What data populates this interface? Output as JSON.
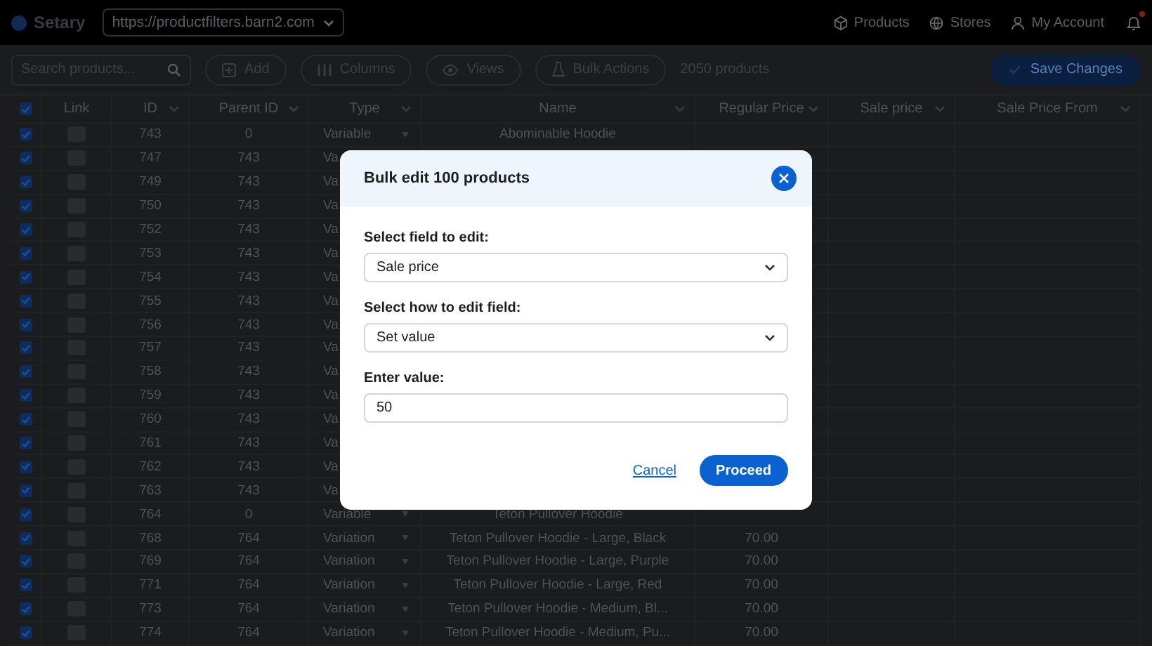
{
  "app_bar": {
    "logo": "Setary",
    "site_url": "https://productfilters.barn2.com",
    "nav": [
      {
        "label": "Products"
      },
      {
        "label": "Stores"
      },
      {
        "label": "My Account"
      }
    ],
    "notifications": {
      "unread": true
    }
  },
  "toolbar": {
    "search": {
      "placeholder": "Search products..."
    },
    "buttons": [
      {
        "label": "Add"
      },
      {
        "label": "Columns"
      },
      {
        "label": "Views"
      },
      {
        "label": "Bulk Actions"
      }
    ],
    "count": "2050 products",
    "save_button": "Save Changes"
  },
  "table": {
    "select_all": {
      "checked": true
    },
    "columns": [
      {
        "label": "Link",
        "filter": false
      },
      {
        "label": "ID",
        "filter": true
      },
      {
        "label": "Parent ID",
        "filter": true
      },
      {
        "label": "Type",
        "filter": true
      },
      {
        "label": "Name",
        "filter": true
      },
      {
        "label": "Regular Price",
        "filter": true
      },
      {
        "label": "Sale price",
        "filter": true
      },
      {
        "label": "Sale Price From",
        "filter": true
      }
    ],
    "rows": [
      {
        "checked": true,
        "id": "743",
        "parent_id": "0",
        "type": "Variable",
        "dropdown": true,
        "name": "Abominable Hoodie"
      },
      {
        "checked": true,
        "id": "747",
        "parent_id": "743",
        "type": "Va",
        "dropdown": false
      },
      {
        "checked": true,
        "id": "749",
        "parent_id": "743",
        "type": "Va",
        "dropdown": false
      },
      {
        "checked": true,
        "id": "750",
        "parent_id": "743",
        "type": "Va",
        "dropdown": false
      },
      {
        "checked": true,
        "id": "752",
        "parent_id": "743",
        "type": "Va",
        "dropdown": false
      },
      {
        "checked": true,
        "id": "753",
        "parent_id": "743",
        "type": "Va",
        "dropdown": false
      },
      {
        "checked": true,
        "id": "754",
        "parent_id": "743",
        "type": "Va",
        "dropdown": false
      },
      {
        "checked": true,
        "id": "755",
        "parent_id": "743",
        "type": "Va",
        "dropdown": false
      },
      {
        "checked": true,
        "id": "756",
        "parent_id": "743",
        "type": "Va",
        "dropdown": false
      },
      {
        "checked": true,
        "id": "757",
        "parent_id": "743",
        "type": "Va",
        "dropdown": false
      },
      {
        "checked": true,
        "id": "758",
        "parent_id": "743",
        "type": "Va",
        "dropdown": false
      },
      {
        "checked": true,
        "id": "759",
        "parent_id": "743",
        "type": "Va",
        "dropdown": false
      },
      {
        "checked": true,
        "id": "760",
        "parent_id": "743",
        "type": "Va",
        "dropdown": false
      },
      {
        "checked": true,
        "id": "761",
        "parent_id": "743",
        "type": "Va",
        "dropdown": false
      },
      {
        "checked": true,
        "id": "762",
        "parent_id": "743",
        "type": "Va",
        "dropdown": false
      },
      {
        "checked": true,
        "id": "763",
        "parent_id": "743",
        "type": "Va",
        "dropdown": false
      },
      {
        "checked": true,
        "id": "764",
        "parent_id": "0",
        "type": "Variable",
        "dropdown": true,
        "name": "Teton Pullover Hoodie"
      },
      {
        "checked": true,
        "id": "768",
        "parent_id": "764",
        "type": "Variation",
        "dropdown": true,
        "name": "Teton Pullover Hoodie - Large, Black",
        "regular_price": "70.00"
      },
      {
        "checked": true,
        "id": "769",
        "parent_id": "764",
        "type": "Variation",
        "dropdown": true,
        "name": "Teton Pullover Hoodie - Large, Purple",
        "regular_price": "70.00"
      },
      {
        "checked": true,
        "id": "771",
        "parent_id": "764",
        "type": "Variation",
        "dropdown": true,
        "name": "Teton Pullover Hoodie - Large, Red",
        "regular_price": "70.00"
      },
      {
        "checked": true,
        "id": "773",
        "parent_id": "764",
        "type": "Variation",
        "dropdown": true,
        "name": "Teton Pullover Hoodie - Medium, Bl...",
        "regular_price": "70.00"
      },
      {
        "checked": true,
        "id": "774",
        "parent_id": "764",
        "type": "Variation",
        "dropdown": true,
        "name": "Teton Pullover Hoodie - Medium, Pu...",
        "regular_price": "70.00"
      }
    ]
  },
  "modal": {
    "title": "Bulk edit 100 products",
    "fields": [
      {
        "kind": "select",
        "label": "Select field to edit:",
        "value": "Sale price"
      },
      {
        "kind": "select",
        "label": "Select how to edit field:",
        "value": "Set value"
      },
      {
        "kind": "input",
        "label": "Enter value:",
        "value": "50"
      }
    ],
    "cancel": "Cancel",
    "proceed": "Proceed"
  }
}
